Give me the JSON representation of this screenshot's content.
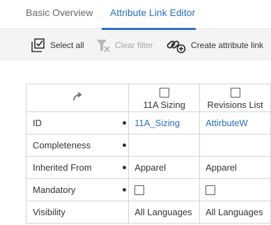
{
  "tabs": [
    {
      "label": "Basic Overview",
      "active": false
    },
    {
      "label": "Attribute Link Editor",
      "active": true
    }
  ],
  "toolbar": {
    "select_all": "Select all",
    "clear_filter": "Clear filter",
    "create_link": "Create attribute link"
  },
  "grid": {
    "columns": [
      {
        "label": "11A Sizing",
        "checked": false
      },
      {
        "label": "Revisions List",
        "checked": false
      }
    ],
    "rows": [
      {
        "label": "ID",
        "values": [
          "11A_Sizing",
          "AttirbuteW"
        ]
      },
      {
        "label": "Completeness",
        "values": [
          "",
          ""
        ]
      },
      {
        "label": "Inherited From",
        "values": [
          "Apparel",
          "Apparel"
        ]
      },
      {
        "label": "Mandatory",
        "values": [
          "",
          ""
        ]
      },
      {
        "label": "Visibility",
        "values": [
          "All Languages",
          "All Languages"
        ]
      }
    ]
  },
  "colors": {
    "accent": "#2a6ebb",
    "disabled": "#a6a6a6",
    "toolbar_bg": "#f4f4f4",
    "border": "#d4d4d4"
  },
  "icons": [
    "select-all-icon",
    "clear-filter-icon",
    "create-link-icon",
    "swap-arrow-icon"
  ]
}
